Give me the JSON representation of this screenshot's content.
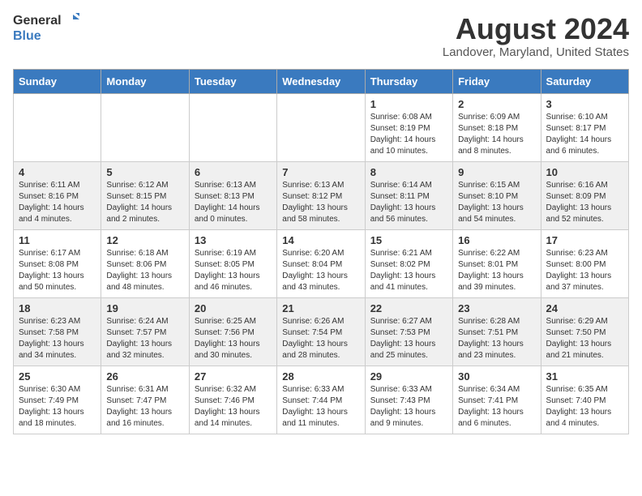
{
  "logo": {
    "general": "General",
    "blue": "Blue"
  },
  "title": "August 2024",
  "subtitle": "Landover, Maryland, United States",
  "days_header": [
    "Sunday",
    "Monday",
    "Tuesday",
    "Wednesday",
    "Thursday",
    "Friday",
    "Saturday"
  ],
  "weeks": [
    [
      {
        "day": "",
        "info": ""
      },
      {
        "day": "",
        "info": ""
      },
      {
        "day": "",
        "info": ""
      },
      {
        "day": "",
        "info": ""
      },
      {
        "day": "1",
        "info": "Sunrise: 6:08 AM\nSunset: 8:19 PM\nDaylight: 14 hours\nand 10 minutes."
      },
      {
        "day": "2",
        "info": "Sunrise: 6:09 AM\nSunset: 8:18 PM\nDaylight: 14 hours\nand 8 minutes."
      },
      {
        "day": "3",
        "info": "Sunrise: 6:10 AM\nSunset: 8:17 PM\nDaylight: 14 hours\nand 6 minutes."
      }
    ],
    [
      {
        "day": "4",
        "info": "Sunrise: 6:11 AM\nSunset: 8:16 PM\nDaylight: 14 hours\nand 4 minutes."
      },
      {
        "day": "5",
        "info": "Sunrise: 6:12 AM\nSunset: 8:15 PM\nDaylight: 14 hours\nand 2 minutes."
      },
      {
        "day": "6",
        "info": "Sunrise: 6:13 AM\nSunset: 8:13 PM\nDaylight: 14 hours\nand 0 minutes."
      },
      {
        "day": "7",
        "info": "Sunrise: 6:13 AM\nSunset: 8:12 PM\nDaylight: 13 hours\nand 58 minutes."
      },
      {
        "day": "8",
        "info": "Sunrise: 6:14 AM\nSunset: 8:11 PM\nDaylight: 13 hours\nand 56 minutes."
      },
      {
        "day": "9",
        "info": "Sunrise: 6:15 AM\nSunset: 8:10 PM\nDaylight: 13 hours\nand 54 minutes."
      },
      {
        "day": "10",
        "info": "Sunrise: 6:16 AM\nSunset: 8:09 PM\nDaylight: 13 hours\nand 52 minutes."
      }
    ],
    [
      {
        "day": "11",
        "info": "Sunrise: 6:17 AM\nSunset: 8:08 PM\nDaylight: 13 hours\nand 50 minutes."
      },
      {
        "day": "12",
        "info": "Sunrise: 6:18 AM\nSunset: 8:06 PM\nDaylight: 13 hours\nand 48 minutes."
      },
      {
        "day": "13",
        "info": "Sunrise: 6:19 AM\nSunset: 8:05 PM\nDaylight: 13 hours\nand 46 minutes."
      },
      {
        "day": "14",
        "info": "Sunrise: 6:20 AM\nSunset: 8:04 PM\nDaylight: 13 hours\nand 43 minutes."
      },
      {
        "day": "15",
        "info": "Sunrise: 6:21 AM\nSunset: 8:02 PM\nDaylight: 13 hours\nand 41 minutes."
      },
      {
        "day": "16",
        "info": "Sunrise: 6:22 AM\nSunset: 8:01 PM\nDaylight: 13 hours\nand 39 minutes."
      },
      {
        "day": "17",
        "info": "Sunrise: 6:23 AM\nSunset: 8:00 PM\nDaylight: 13 hours\nand 37 minutes."
      }
    ],
    [
      {
        "day": "18",
        "info": "Sunrise: 6:23 AM\nSunset: 7:58 PM\nDaylight: 13 hours\nand 34 minutes."
      },
      {
        "day": "19",
        "info": "Sunrise: 6:24 AM\nSunset: 7:57 PM\nDaylight: 13 hours\nand 32 minutes."
      },
      {
        "day": "20",
        "info": "Sunrise: 6:25 AM\nSunset: 7:56 PM\nDaylight: 13 hours\nand 30 minutes."
      },
      {
        "day": "21",
        "info": "Sunrise: 6:26 AM\nSunset: 7:54 PM\nDaylight: 13 hours\nand 28 minutes."
      },
      {
        "day": "22",
        "info": "Sunrise: 6:27 AM\nSunset: 7:53 PM\nDaylight: 13 hours\nand 25 minutes."
      },
      {
        "day": "23",
        "info": "Sunrise: 6:28 AM\nSunset: 7:51 PM\nDaylight: 13 hours\nand 23 minutes."
      },
      {
        "day": "24",
        "info": "Sunrise: 6:29 AM\nSunset: 7:50 PM\nDaylight: 13 hours\nand 21 minutes."
      }
    ],
    [
      {
        "day": "25",
        "info": "Sunrise: 6:30 AM\nSunset: 7:49 PM\nDaylight: 13 hours\nand 18 minutes."
      },
      {
        "day": "26",
        "info": "Sunrise: 6:31 AM\nSunset: 7:47 PM\nDaylight: 13 hours\nand 16 minutes."
      },
      {
        "day": "27",
        "info": "Sunrise: 6:32 AM\nSunset: 7:46 PM\nDaylight: 13 hours\nand 14 minutes."
      },
      {
        "day": "28",
        "info": "Sunrise: 6:33 AM\nSunset: 7:44 PM\nDaylight: 13 hours\nand 11 minutes."
      },
      {
        "day": "29",
        "info": "Sunrise: 6:33 AM\nSunset: 7:43 PM\nDaylight: 13 hours\nand 9 minutes."
      },
      {
        "day": "30",
        "info": "Sunrise: 6:34 AM\nSunset: 7:41 PM\nDaylight: 13 hours\nand 6 minutes."
      },
      {
        "day": "31",
        "info": "Sunrise: 6:35 AM\nSunset: 7:40 PM\nDaylight: 13 hours\nand 4 minutes."
      }
    ]
  ]
}
